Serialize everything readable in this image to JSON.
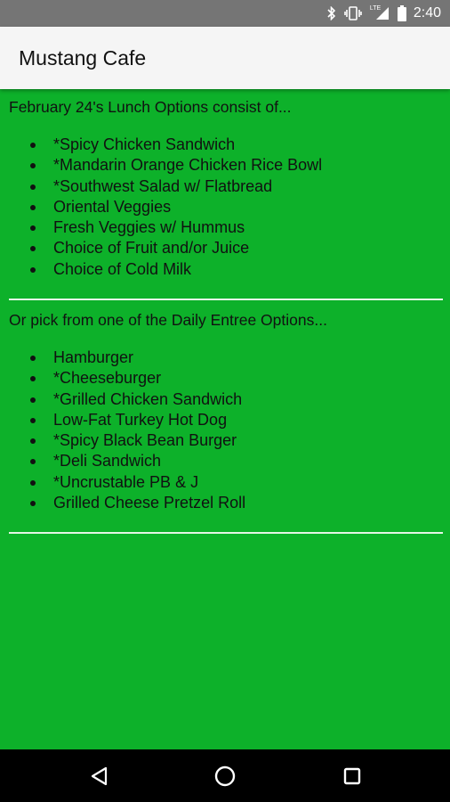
{
  "status_bar": {
    "time": "2:40",
    "network_label": "LTE",
    "icons": [
      "bluetooth-icon",
      "vibrate-icon",
      "lte-signal-icon",
      "battery-icon"
    ]
  },
  "app_bar": {
    "title": "Mustang Cafe"
  },
  "lunch": {
    "intro": "February 24's Lunch Options consist of...",
    "items": [
      "*Spicy Chicken Sandwich",
      "*Mandarin Orange Chicken Rice Bowl",
      "*Southwest Salad w/ Flatbread",
      "Oriental Veggies",
      "Fresh Veggies w/ Hummus",
      "Choice of Fruit and/or Juice",
      "Choice of Cold Milk"
    ]
  },
  "daily": {
    "intro": "Or pick from one of the Daily Entree Options...",
    "items": [
      "Hamburger",
      "*Cheeseburger",
      "*Grilled Chicken Sandwich",
      "Low-Fat Turkey Hot Dog",
      "*Spicy Black Bean Burger",
      "*Deli Sandwich",
      "*Uncrustable PB & J",
      "Grilled Cheese Pretzel Roll"
    ]
  },
  "nav_bar": {
    "icons": [
      "back-icon",
      "home-icon",
      "recents-icon"
    ]
  },
  "colors": {
    "background": "#0db12a",
    "status_bar": "#757575",
    "app_bar": "#f5f5f5",
    "nav_bar": "#000000",
    "text": "#111111",
    "divider": "#e6f5e6"
  }
}
